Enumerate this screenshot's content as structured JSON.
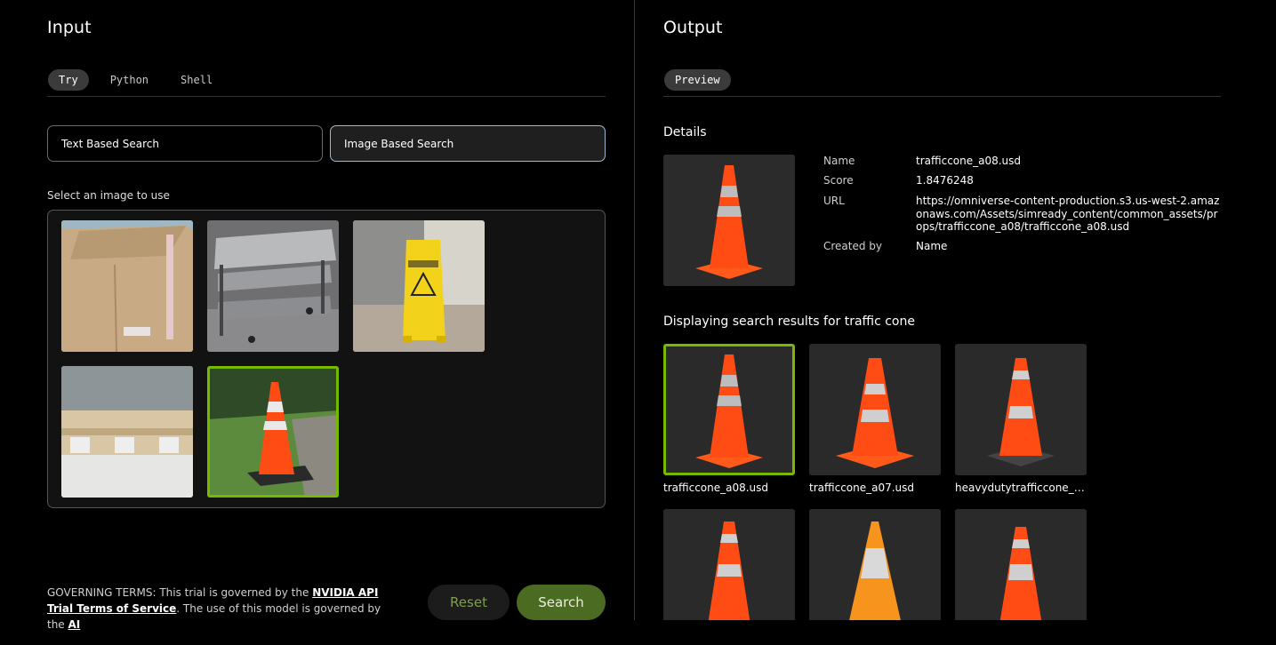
{
  "input": {
    "title": "Input",
    "tabs": [
      {
        "label": "Try",
        "active": true
      },
      {
        "label": "Python",
        "active": false
      },
      {
        "label": "Shell",
        "active": false
      }
    ],
    "mode_buttons": [
      {
        "label": "Text Based Search",
        "selected": false
      },
      {
        "label": "Image Based Search",
        "selected": true
      }
    ],
    "select_label": "Select an image to use",
    "images": [
      {
        "name": "cardboard-box",
        "selected": false
      },
      {
        "name": "metal-cart",
        "selected": false
      },
      {
        "name": "wet-floor-sign",
        "selected": false
      },
      {
        "name": "wooden-pallet",
        "selected": false
      },
      {
        "name": "traffic-cone",
        "selected": true
      }
    ],
    "terms": {
      "prefix": "GOVERNING TERMS: This trial is governed by the ",
      "link1": "NVIDIA API Trial Terms of Service",
      "middle": ". The use of this model is governed by the ",
      "link2": "AI"
    },
    "reset_label": "Reset",
    "search_label": "Search"
  },
  "output": {
    "title": "Output",
    "tabs": [
      {
        "label": "Preview",
        "active": true
      }
    ],
    "details_title": "Details",
    "details": {
      "name_label": "Name",
      "name_value": "trafficcone_a08.usd",
      "score_label": "Score",
      "score_value": "1.8476248",
      "url_label": "URL",
      "url_value": "https://omniverse-content-production.s3.us-west-2.amazonaws.com/Assets/simready_content/common_assets/props/trafficcone_a08/trafficcone_a08.usd",
      "created_label": "Created by",
      "created_value": "Name"
    },
    "results_title": "Displaying search results for traffic cone",
    "results": [
      {
        "caption": "trafficcone_a08.usd",
        "selected": true
      },
      {
        "caption": "trafficcone_a07.usd",
        "selected": false
      },
      {
        "caption": "heavydutytrafficcone_a...",
        "selected": false
      },
      {
        "caption": "",
        "selected": false
      },
      {
        "caption": "",
        "selected": false
      },
      {
        "caption": "",
        "selected": false
      }
    ]
  },
  "colors": {
    "accent_green": "#76b900",
    "search_button": "#4b6a22",
    "selected_border": "#9db9d3"
  }
}
